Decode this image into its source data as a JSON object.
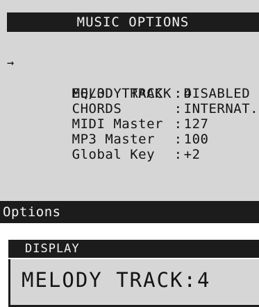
{
  "screen": {
    "title": "MUSIC OPTIONS",
    "options": [
      {
        "label": "MELODY TRACK",
        "sep": ":",
        "value": "4",
        "selected": true
      },
      {
        "label": "EQ/3D TRACK",
        "sep": ":",
        "value": "DISABLED",
        "selected": false
      },
      {
        "label": "CHORDS",
        "sep": ":",
        "value": "INTERNAT.",
        "selected": false
      },
      {
        "label": "MIDI Master",
        "sep": ":",
        "value": "127",
        "selected": false
      },
      {
        "label": "MP3 Master",
        "sep": ":",
        "value": "100",
        "selected": false
      },
      {
        "label": "Global Key",
        "sep": ":",
        "value": "+2",
        "selected": false
      }
    ],
    "bottom_label": "Options"
  },
  "display": {
    "header": "DISPLAY",
    "text": "MELODY TRACK:4"
  },
  "icons": {
    "selection_arrow": "right-arrow-icon",
    "selection_glyph": "→"
  },
  "colors": {
    "screen_bg": "#d6d6d6",
    "bar_bg": "#1c1c1c",
    "bar_text": "#f2f2f2",
    "text": "#141414"
  }
}
